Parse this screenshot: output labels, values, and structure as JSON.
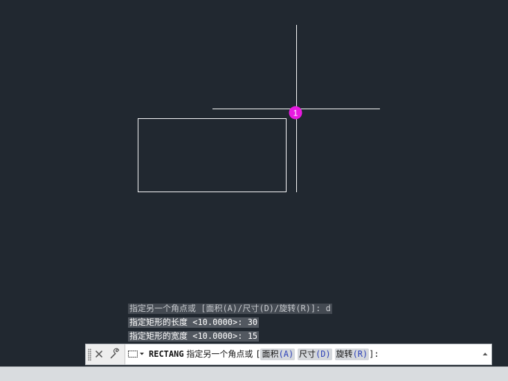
{
  "canvas": {
    "background_color": "#212830",
    "geometry_color": "#ffffff",
    "marker_color": "#e81ae0",
    "marker_label": "1"
  },
  "command_history": [
    "指定另一个角点或 [面积(A)/尺寸(D)/旋转(R)]: d",
    "指定矩形的长度 <10.0000>: 30",
    "指定矩形的宽度 <10.0000>: 15"
  ],
  "command_line": {
    "close_icon": "close-icon",
    "customize_icon": "wrench-icon",
    "prompt_icon": "rectangle-select-icon",
    "command_name": "RECTANG",
    "prompt_text": "指定另一个角点或",
    "bracket_open": "[",
    "options": [
      {
        "label": "面积",
        "key": "(A)"
      },
      {
        "label": "尺寸",
        "key": "(D)"
      },
      {
        "label": "旋转",
        "key": "(R)"
      }
    ],
    "bracket_close": "]:",
    "history_toggle_icon": "caret-up-icon"
  }
}
